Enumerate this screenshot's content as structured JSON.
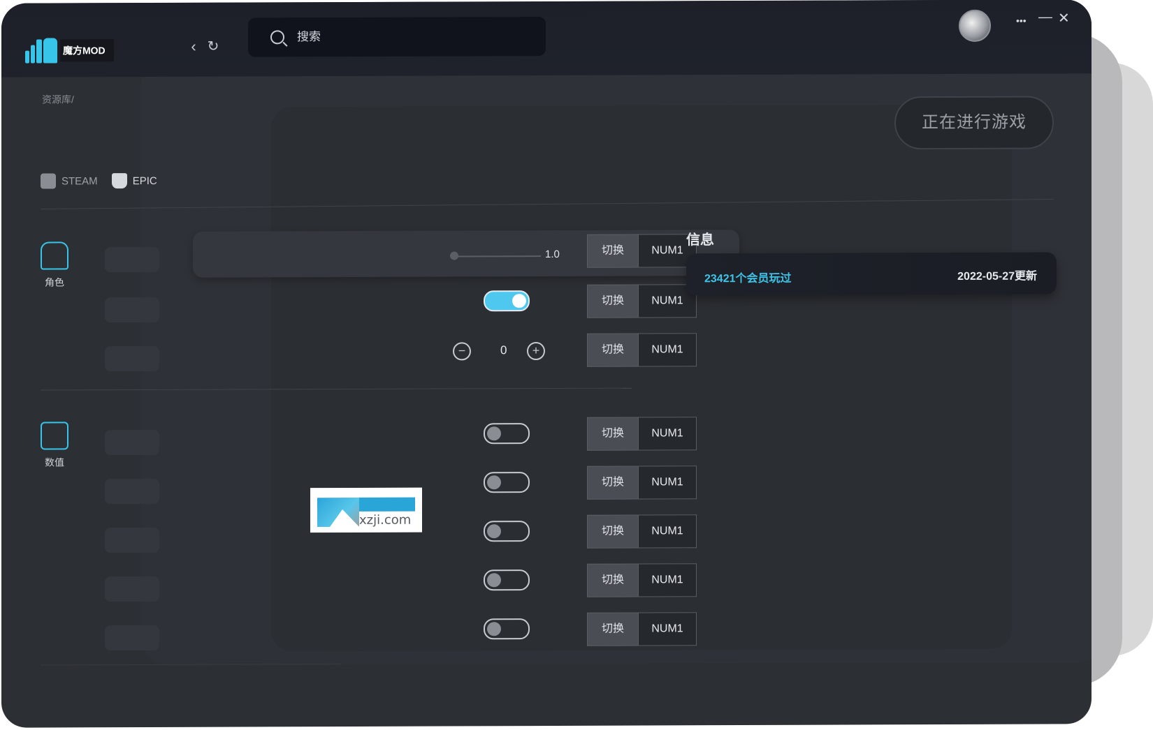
{
  "app": {
    "name": "魔方MOD"
  },
  "header": {
    "search_placeholder": "搜索",
    "back_label": "‹",
    "refresh_label": "↻",
    "more_label": "•••",
    "minimize_label": "—",
    "close_label": "✕"
  },
  "breadcrumb": "资源库/",
  "playing_button": "正在进行游戏",
  "platforms": [
    {
      "label": "STEAM",
      "icon": "steam-icon"
    },
    {
      "label": "EPIC",
      "icon": "epic-icon"
    }
  ],
  "categories": [
    {
      "label": "角色",
      "icon": "character-icon"
    },
    {
      "label": "数值",
      "icon": "stats-icon"
    }
  ],
  "rows": [
    {
      "control": "slider",
      "value": "1.0",
      "switch_label": "切换",
      "key": "NUM1"
    },
    {
      "control": "toggle",
      "on": true,
      "switch_label": "切换",
      "key": "NUM1"
    },
    {
      "control": "stepper",
      "value": "0",
      "minus": "−",
      "plus": "+",
      "switch_label": "切换",
      "key": "NUM1"
    },
    {
      "control": "toggle",
      "on": false,
      "switch_label": "切换",
      "key": "NUM1"
    },
    {
      "control": "toggle",
      "on": false,
      "switch_label": "切换",
      "key": "NUM1"
    },
    {
      "control": "toggle",
      "on": false,
      "switch_label": "切换",
      "key": "NUM1"
    },
    {
      "control": "toggle",
      "on": false,
      "switch_label": "切换",
      "key": "NUM1"
    },
    {
      "control": "toggle",
      "on": false,
      "switch_label": "切换",
      "key": "NUM1"
    }
  ],
  "info": {
    "title": "信息",
    "players": "23421个会员玩过",
    "updated": "2022-05-27更新"
  },
  "watermark": {
    "text": "xzji.com"
  },
  "colors": {
    "accent": "#37c6ea",
    "background": "#2c2f34",
    "titlebar": "#1d2029"
  }
}
